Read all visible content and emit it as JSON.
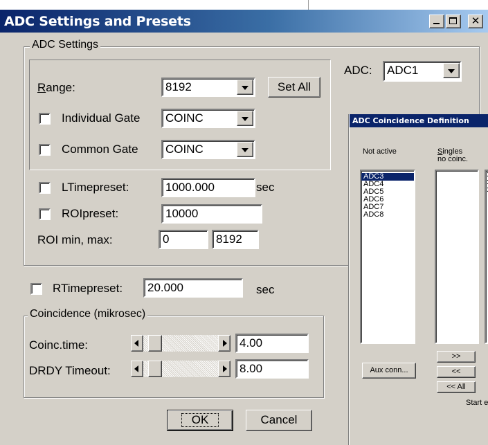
{
  "window": {
    "title": "ADC Settings and Presets",
    "min_icon": "minimize-icon",
    "max_icon": "maximize-icon",
    "close_icon": "close-icon"
  },
  "adc_settings": {
    "group_label": "ADC Settings",
    "range_label": "Range:",
    "range_value": "8192",
    "set_all_label": "Set All",
    "individual_gate_label": "Individual Gate",
    "individual_gate_value": "COINC",
    "common_gate_label": "Common Gate",
    "common_gate_value": "COINC",
    "ltimepreset_label": "LTimepreset:",
    "ltimepreset_value": "1000.000",
    "ltimepreset_unit": "sec",
    "roipreset_label": "ROIpreset:",
    "roipreset_value": "10000",
    "roi_minmax_label": "ROI min, max:",
    "roi_min": "0",
    "roi_max": "8192"
  },
  "adc": {
    "label": "ADC:",
    "value": "ADC1"
  },
  "rtimepreset": {
    "label": "RTimepreset:",
    "value": "20.000",
    "unit": "sec"
  },
  "coincidence": {
    "group_label": "Coincidence (mikrosec)",
    "coinc_time_label": "Coinc.time:",
    "coinc_time_value": "4.00",
    "coinc_time_position": 0.08,
    "drdy_label": "DRDY Timeout:",
    "drdy_value": "8.00",
    "drdy_position": 0.08
  },
  "buttons": {
    "ok": "OK",
    "cancel": "Cancel"
  },
  "coinc_dialog": {
    "title": "ADC Coincidence Definition",
    "not_active_label": "Not active",
    "singles_label_1": "Singles",
    "singles_label_2": "no coinc.",
    "not_active_items": [
      "ADC3",
      "ADC4",
      "ADC5",
      "ADC6",
      "ADC7",
      "ADC8"
    ],
    "selected_item": "ADC3",
    "aux_conn_label": "Aux conn...",
    "move_right_label": ">>",
    "move_left_label": "<<",
    "move_all_left_label": "<< All",
    "start_label": "Start e"
  },
  "colors": {
    "face": "#d4d0c8",
    "title_active": "#0a246a",
    "title_gradient_end": "#a6caf0"
  }
}
